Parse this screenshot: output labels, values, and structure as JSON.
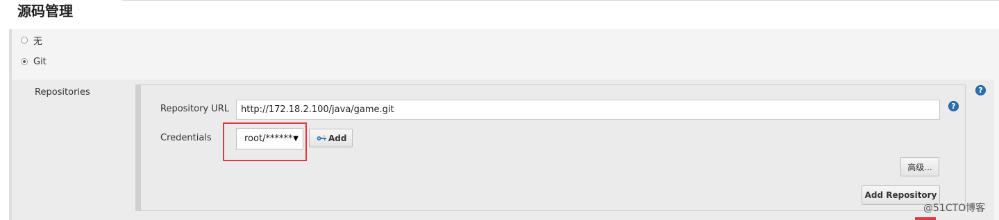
{
  "section": {
    "title": "源码管理"
  },
  "scm_options": [
    {
      "label": "无",
      "checked": false
    },
    {
      "label": "Git",
      "checked": true
    }
  ],
  "git": {
    "repositories_label": "Repositories",
    "repository_url_label": "Repository URL",
    "repository_url_value": "http://172.18.2.100/java/game.git",
    "credentials_label": "Credentials",
    "credentials_selected": "root/******",
    "add_button": "Add",
    "advanced_button": "高级...",
    "add_repository_button": "Add Repository",
    "help_glyph": "?"
  },
  "watermark": "@51CTO博客",
  "colors": {
    "highlight": "#e0393e",
    "help": "#2a6fb0"
  },
  "icons": {
    "key": "key-icon",
    "help": "help-icon",
    "dropdown": "chevron-down-icon"
  }
}
